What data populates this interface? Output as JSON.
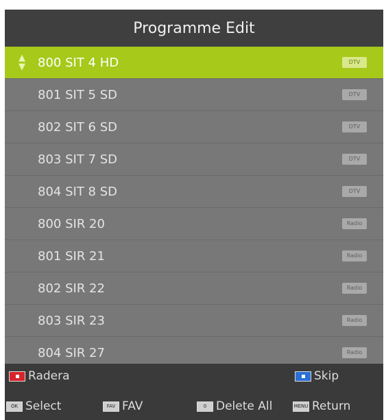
{
  "header": {
    "title": "Programme Edit"
  },
  "channels": [
    {
      "name": "800 SIT 4 HD",
      "type": "DTV",
      "selected": true
    },
    {
      "name": "801 SIT 5 SD",
      "type": "DTV"
    },
    {
      "name": "802 SIT 6 SD",
      "type": "DTV"
    },
    {
      "name": "803 SIT 7 SD",
      "type": "DTV"
    },
    {
      "name": "804 SIT 8 SD",
      "type": "DTV"
    },
    {
      "name": "800 SIR 20",
      "type": "Radio"
    },
    {
      "name": "801 SIR 21",
      "type": "Radio"
    },
    {
      "name": "802 SIR 22",
      "type": "Radio"
    },
    {
      "name": "803 SIR 23",
      "type": "Radio"
    },
    {
      "name": "804 SIR 27",
      "type": "Radio"
    }
  ],
  "legend": {
    "red_label": "Radera",
    "blue_label": "Skip",
    "ok_key": "OK",
    "ok_label": "Select",
    "fav_key": "FAV",
    "fav_label": "FAV",
    "zero_key": "0",
    "delete_all_label": "Delete All",
    "menu_key": "MENU",
    "return_label": "Return"
  },
  "colors": {
    "selected_row": "#a6c91a",
    "red_key": "#d7242a",
    "blue_key": "#2b6fd6"
  }
}
